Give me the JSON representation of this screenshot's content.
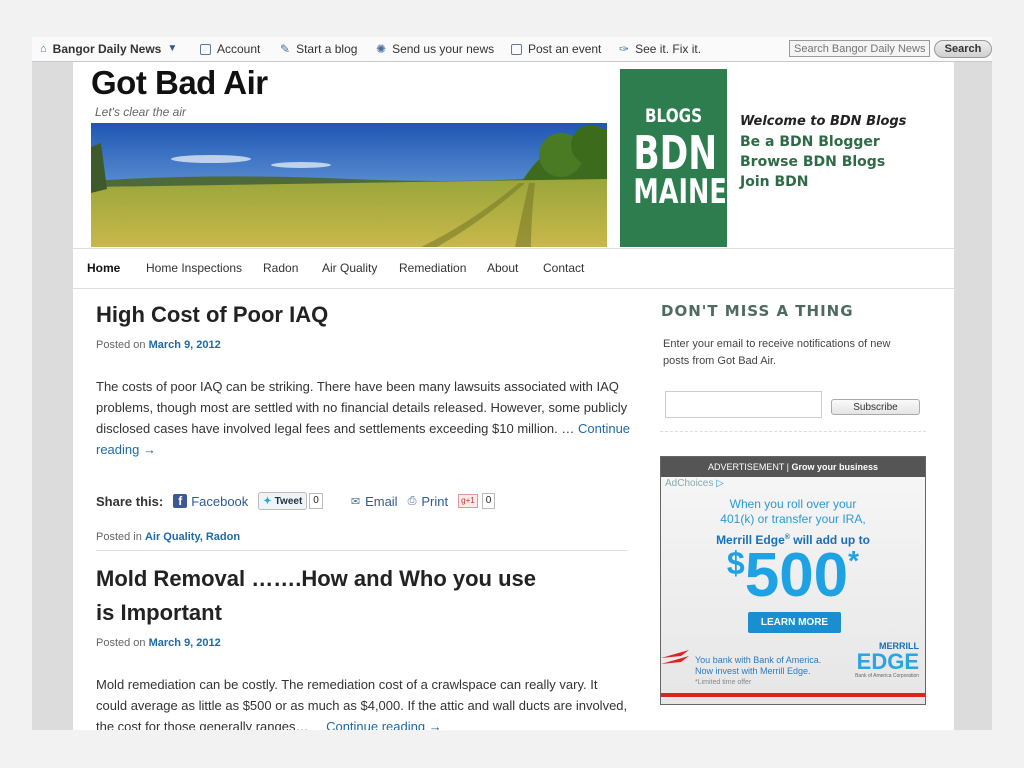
{
  "topbar": {
    "site": "Bangor Daily News",
    "items": [
      {
        "label": "Account",
        "icon": "account-icon"
      },
      {
        "label": "Start a blog",
        "icon": "pencil-icon"
      },
      {
        "label": "Send us your news",
        "icon": "bulb-icon"
      },
      {
        "label": "Post an event",
        "icon": "calendar-icon"
      },
      {
        "label": "See it. Fix it.",
        "icon": "wrench-icon"
      }
    ],
    "search_placeholder": "Search Bangor Daily News",
    "search_button": "Search"
  },
  "site": {
    "title": "Got Bad Air",
    "tagline": "Let's clear the air"
  },
  "bdn_logo": {
    "line1": "BLOGS",
    "line2": "BDN",
    "line3": "MAINE",
    "color": "#2e7d4f"
  },
  "bdn_links": {
    "welcome": "Welcome to BDN Blogs",
    "links": [
      "Be a BDN Blogger",
      "Browse BDN Blogs",
      "Join BDN"
    ]
  },
  "nav": [
    "Home",
    "Home Inspections",
    "Radon",
    "Air Quality",
    "Remediation",
    "About",
    "Contact"
  ],
  "posts": [
    {
      "title": "High Cost of Poor IAQ",
      "posted_prefix": "Posted on",
      "date": "March 9, 2012",
      "excerpt_lines": [
        "The costs of poor IAQ can be striking. There have been many lawsuits associated with IAQ",
        "problems, though most are settled with no financial details released. However, some publicly",
        "disclosed cases have involved legal fees and settlements exceeding $10 million. … "
      ],
      "continue_a": "Continue",
      "continue_b": "reading →",
      "share_label": "Share this:",
      "facebook": "Facebook",
      "tweet": "Tweet",
      "tweet_count": "0",
      "email": "Email",
      "print": "Print",
      "plus_count": "0",
      "categories_prefix": "Posted in",
      "categories": "Air Quality, Radon"
    },
    {
      "title_l1": "Mold Removal …….How and Who you use",
      "title_l2": "is Important",
      "posted_prefix": "Posted on",
      "date": "March 9, 2012",
      "excerpt_lines": [
        "Mold remediation can be costly.  The remediation cost of a crawlspace can really vary. It",
        "could average as little as $500 or as much as $4,000. If the attic and wall ducts are involved,",
        "the cost for those generally ranges…"
      ],
      "continue": "Continue reading →"
    }
  ],
  "sidebar": {
    "title": "DON'T MISS A THING",
    "text": "Enter your email to receive notifications of new posts from Got Bad Air.",
    "subscribe": "Subscribe"
  },
  "ad": {
    "header_a": "ADVERTISEMENT",
    "header_b": "Grow your business",
    "adchoices": "AdChoices",
    "line1": "When you roll over your",
    "line2": "401(k) or transfer your IRA,",
    "line3": "Merrill Edge",
    "line3b": " will add up to",
    "amount_sign": "$",
    "amount": "500",
    "amount_star": "*",
    "button": "LEARN MORE",
    "foot1": "You bank with Bank of America.",
    "foot2": "Now invest with Merrill Edge.",
    "foot3": "*Limited time offer",
    "brand1": "MERRILL",
    "brand2": "EDGE",
    "brand3": "Bank of America Corporation"
  }
}
